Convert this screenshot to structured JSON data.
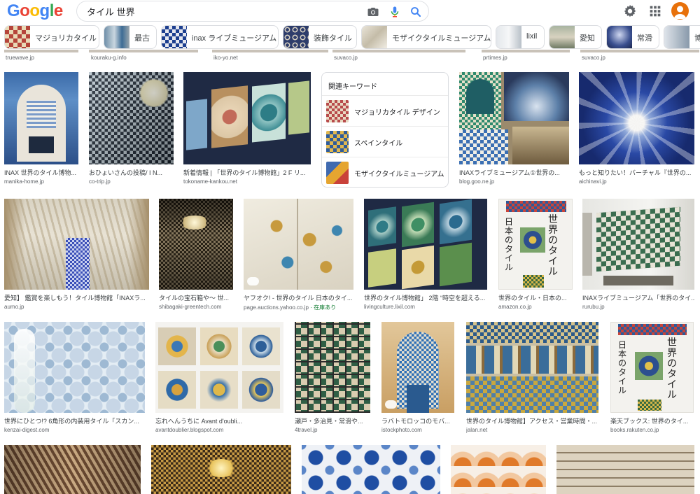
{
  "header": {
    "logo": "Google",
    "search_value": "タイル 世界"
  },
  "colors": {
    "blue": "#4285f4",
    "red": "#ea4335",
    "yellow": "#fbbc05",
    "green": "#34a853",
    "stock_green": "#188038"
  },
  "chips": [
    {
      "label": "マジョリカタイル"
    },
    {
      "label": "最古"
    },
    {
      "label": "inax ライブミュージアム"
    },
    {
      "label": "装飾タイル"
    },
    {
      "label": "モザイクタイルミュージアム"
    },
    {
      "label": "lixil"
    },
    {
      "label": "愛知"
    },
    {
      "label": "常滑"
    },
    {
      "label": "博"
    }
  ],
  "top_sources": [
    "truewave.jp",
    "kouraku-g.info",
    "iko-yo.net",
    "suvaco.jp",
    "prtimes.jp",
    "suvaco.jp"
  ],
  "related": {
    "title": "関連キーワード",
    "items": [
      {
        "label": "マジョリカタイル デザイン"
      },
      {
        "label": "スペインタイル"
      },
      {
        "label": "モザイクタイルミュージアム"
      }
    ]
  },
  "row1": [
    {
      "title": "INAX 世界のタイル博物...",
      "source": "manika-home.jp"
    },
    {
      "title": "おひょいさんの投稿/ I N...",
      "source": "co-trip.jp"
    },
    {
      "title": "新着情報 | 「世界のタイル博物館」2 F リ...",
      "source": "tokoname-kankou.net"
    },
    {
      "title": "INAXライブミュージアム①世界の...",
      "source": "blog.goo.ne.jp"
    },
    {
      "title": "もっと知りたい！バーチャル『世界の...",
      "source": "aichinavi.jp"
    }
  ],
  "row2": [
    {
      "title": "愛知】 鑑賞を楽しもう！タイル博物館「INAXラ...",
      "source": "aumo.jp"
    },
    {
      "title": "タイルの宝石箱や〜 世...",
      "source": "shibagaki-greentech.com"
    },
    {
      "title": "ヤフオク! - 世界のタイル 日本のタイ...",
      "source": "page.auctions.yahoo.co.jp",
      "stock": " · 在庫あり"
    },
    {
      "title": "世界のタイル博物館」 2階 “時空を超える...",
      "source": "livingculture.lixil.com"
    },
    {
      "title": "世界のタイル・日本の...",
      "source": "amazon.co.jp"
    },
    {
      "title": "INAXライブミュージアム「世界のタイ...",
      "source": "rurubu.jp"
    }
  ],
  "row3": [
    {
      "title": "世界にひとつ!? 6角形の内装用タイル「スカン...",
      "source": "kenzai-digest.com"
    },
    {
      "title": "忘れへんうちに Avant d'oubli...",
      "source": "avantdoublier.blogspot.com"
    },
    {
      "title": "瀬戸・多治見・常滑や...",
      "source": "4travel.jp"
    },
    {
      "title": "ラバトモロッコのモバ...",
      "source": "istockphoto.com"
    },
    {
      "title": "世界のタイル博物館】アクセス・営業時間・...",
      "source": "jalan.net"
    },
    {
      "title": "楽天ブックス: 世界のタイ...",
      "source": "books.rakuten.co.jp"
    }
  ],
  "book": {
    "vertical_1": "世界のタイル",
    "vertical_2": "日本のタイル"
  }
}
